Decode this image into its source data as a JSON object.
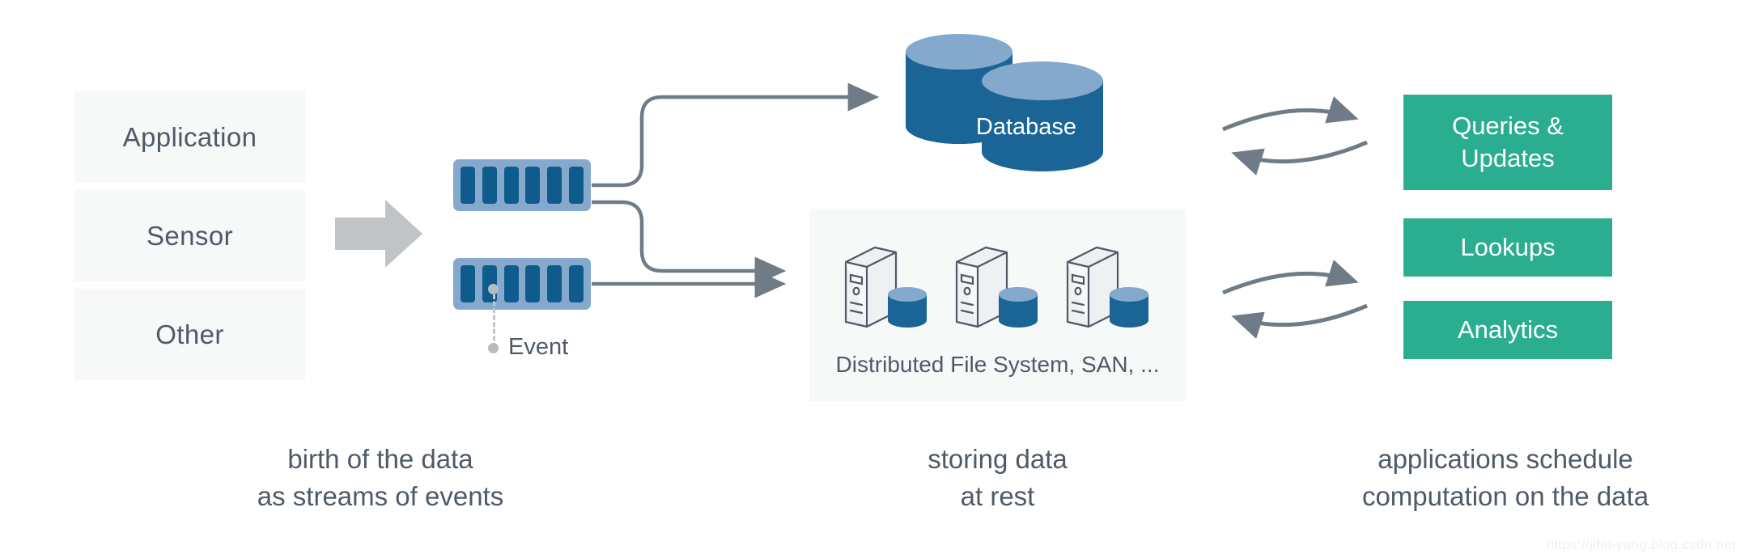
{
  "diagram": {
    "sources": [
      {
        "label": "Application"
      },
      {
        "label": "Sensor"
      },
      {
        "label": "Other"
      }
    ],
    "streams": {
      "segments_per_stream": 6,
      "event_label": "Event"
    },
    "database": {
      "label": "Database"
    },
    "storage": {
      "caption": "Distributed File System, SAN, ...",
      "server_count": 3
    },
    "actions": [
      {
        "label": "Queries &\nUpdates"
      },
      {
        "label": "Lookups"
      },
      {
        "label": "Analytics"
      }
    ],
    "captions": [
      {
        "text": "birth of the data\nas streams of events"
      },
      {
        "text": "storing data\nat rest"
      },
      {
        "text": "applications schedule\ncomputation on the data"
      }
    ],
    "watermark": "https://jifei-yang.blog.csdn.net",
    "colors": {
      "source_box_bg": "#f7f8f8",
      "text": "#4e5a67",
      "stream_bg": "#85a9cd",
      "stream_segment": "#0f5c8c",
      "arrow_gray": "#c0c4c7",
      "connector": "#6f7b87",
      "db_body": "#1a6496",
      "db_top": "#85a9cd",
      "accent_green": "#2bae8f",
      "panel_bg": "#f7f8f8"
    }
  }
}
